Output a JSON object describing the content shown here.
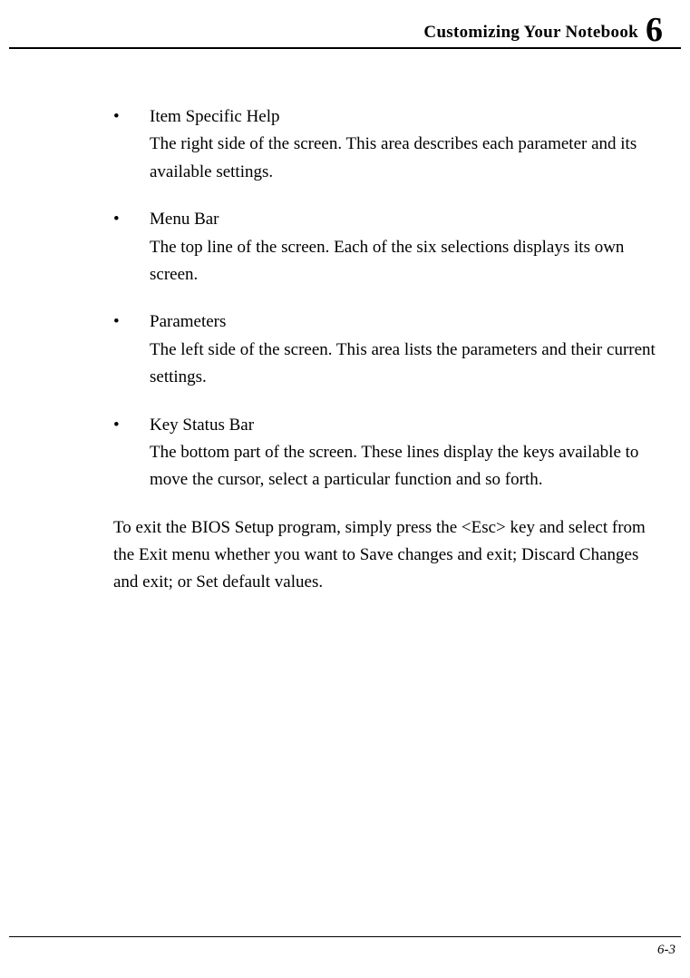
{
  "header": {
    "title": "Customizing Your Notebook",
    "chapter_number": "6"
  },
  "bullets": [
    {
      "title": "Item Specific Help",
      "desc": "The right side of the screen. This area describes each parameter and its available settings."
    },
    {
      "title": "Menu Bar",
      "desc": "The top line of the screen. Each of the six selections displays its own screen."
    },
    {
      "title": "Parameters",
      "desc": "The left side of the screen. This area lists the parameters and their current settings."
    },
    {
      "title": "Key Status Bar",
      "desc": "The bottom part of the screen. These lines display the keys available to move the cursor, select a particular function and so forth."
    }
  ],
  "paragraph": "To exit the BIOS Setup program, simply press the <Esc> key and select from the Exit menu whether you want to Save changes and exit; Discard Changes and exit; or Set default values.",
  "footer": {
    "page_number": "6-3"
  }
}
